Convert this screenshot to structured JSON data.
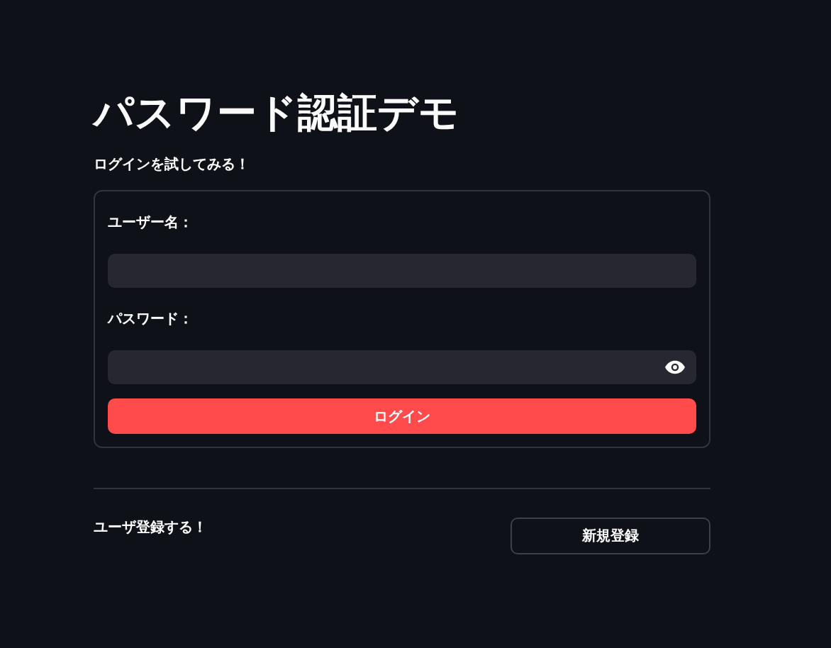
{
  "title": "パスワード認証デモ",
  "caption": "ログインを試してみる！",
  "login_form": {
    "fields": [
      {
        "label": "ユーザー名：",
        "kind": "text"
      },
      {
        "label": "パスワード：",
        "kind": "password"
      }
    ],
    "submit": "ログイン"
  },
  "register": {
    "text": "ユーザ登録する！",
    "button": "新規登録"
  }
}
